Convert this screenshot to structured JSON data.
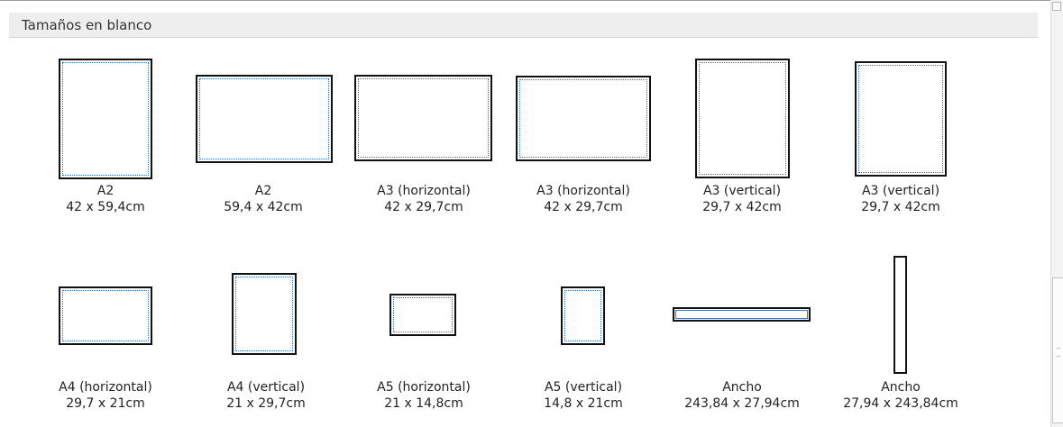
{
  "section": {
    "title": "Tamaños en blanco"
  },
  "tiles": [
    {
      "name": "A2",
      "size": "42 x 59,4cm"
    },
    {
      "name": "A2",
      "size": "59,4 x 42cm"
    },
    {
      "name": "A3 (horizontal)",
      "size": "42 x 29,7cm"
    },
    {
      "name": "A3 (horizontal)",
      "size": "42 x 29,7cm"
    },
    {
      "name": "A3 (vertical)",
      "size": "29,7 x 42cm"
    },
    {
      "name": "A3 (vertical)",
      "size": "29,7 x 42cm"
    },
    {
      "name": "A4 (horizontal)",
      "size": "29,7 x 21cm"
    },
    {
      "name": "A4 (vertical)",
      "size": "21 x 29,7cm"
    },
    {
      "name": "A5 (horizontal)",
      "size": "21 x 14,8cm"
    },
    {
      "name": "A5 (vertical)",
      "size": "14,8 x 21cm"
    },
    {
      "name": "Ancho",
      "size": "243,84 x 27,94cm"
    },
    {
      "name": "Ancho",
      "size": "27,94 x 243,84cm"
    }
  ],
  "colors": {
    "page_border": "#111111",
    "margin_guide": "#1f6fd6",
    "header_bg": "#eeeeee"
  }
}
